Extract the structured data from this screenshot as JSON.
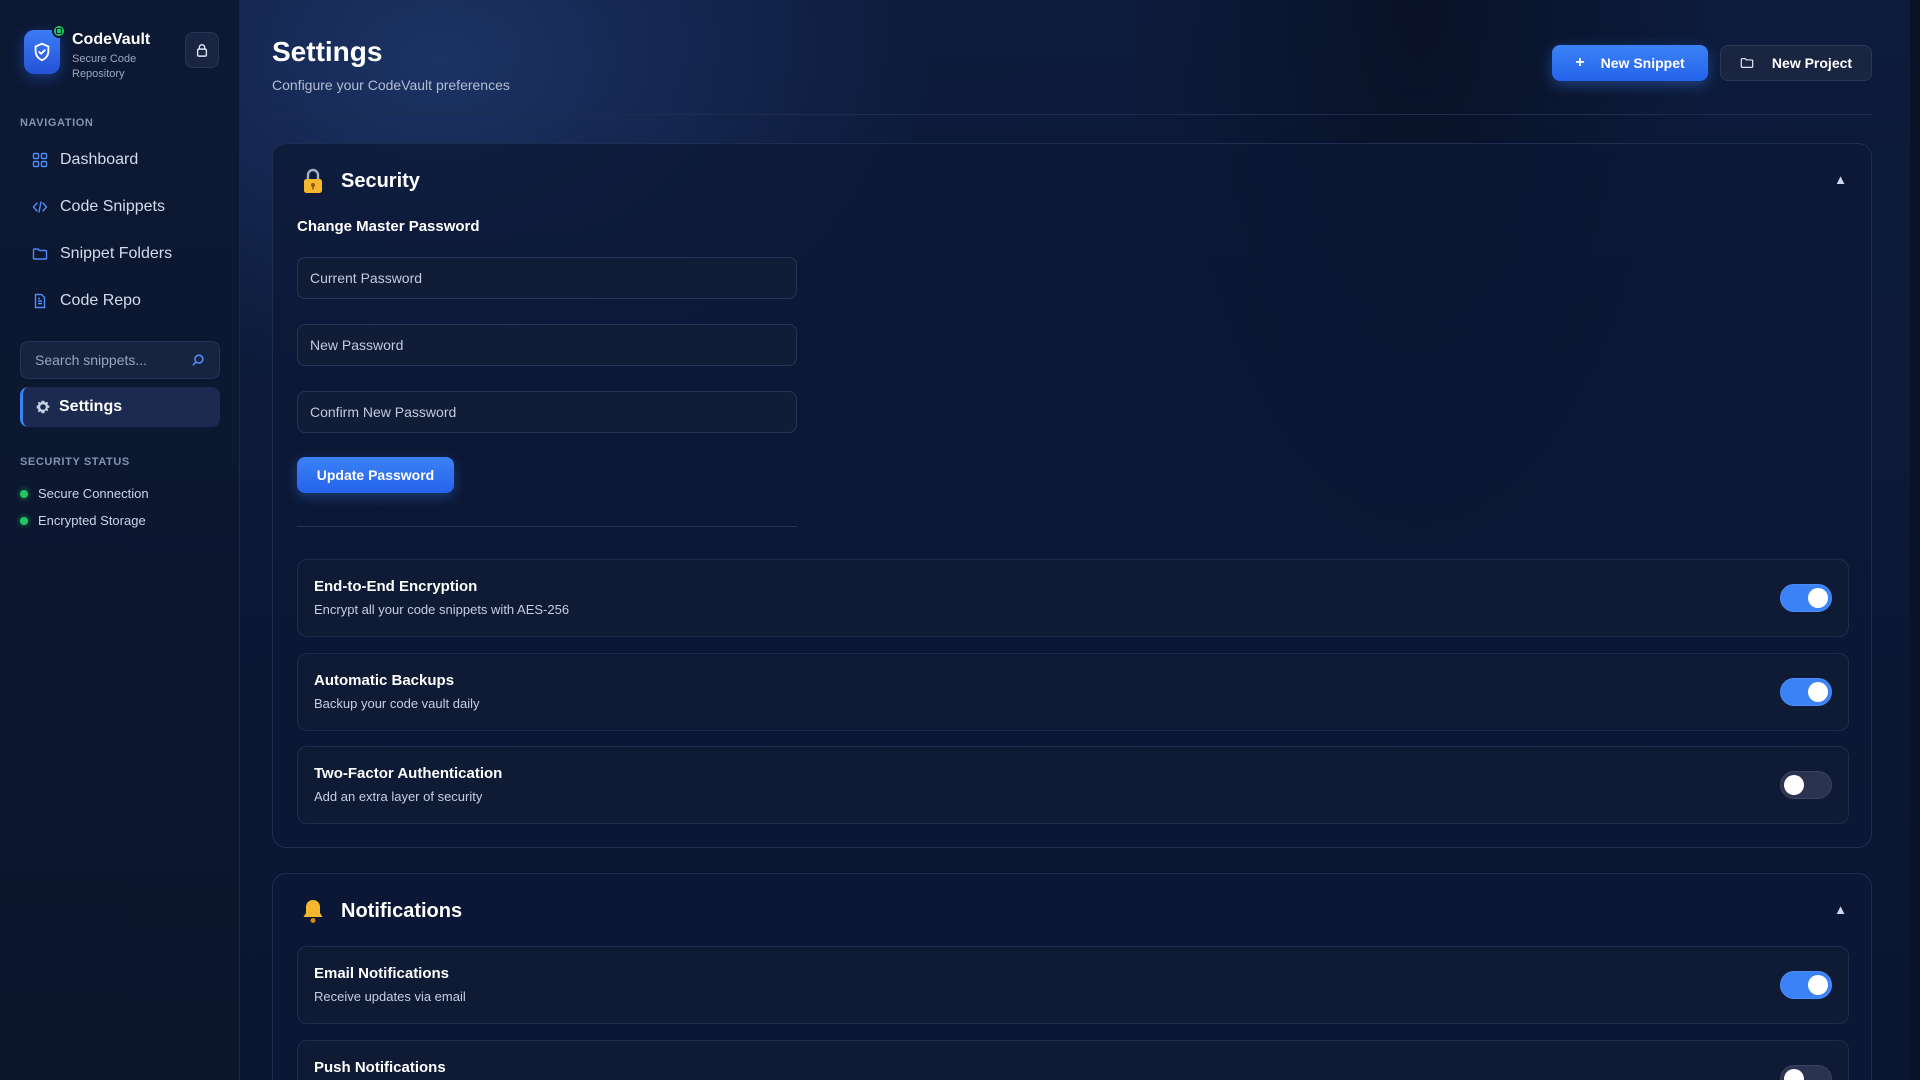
{
  "sidebar": {
    "brand_name": "CodeVault",
    "brand_sub": "Secure Code Repository",
    "nav_label": "NAVIGATION",
    "items": [
      {
        "label": "Dashboard",
        "icon": "grid-icon"
      },
      {
        "label": "Code Snippets",
        "icon": "code-icon"
      },
      {
        "label": "Snippet Folders",
        "icon": "folder-icon"
      },
      {
        "label": "Code Repo",
        "icon": "file-icon"
      }
    ],
    "search_placeholder": "Search snippets...",
    "settings_label": "Settings",
    "status_label": "SECURITY STATUS",
    "status": [
      {
        "label": "Secure Connection",
        "color": "#22c55e"
      },
      {
        "label": "Encrypted Storage",
        "color": "#22c55e"
      }
    ]
  },
  "header": {
    "title": "Settings",
    "subtitle": "Configure your CodeVault preferences",
    "new_snippet": "New Snippet",
    "new_project": "New Project"
  },
  "security": {
    "title": "Security",
    "change_pw_title": "Change Master Password",
    "current_pw_placeholder": "Current Password",
    "new_pw_placeholder": "New Password",
    "confirm_pw_placeholder": "Confirm New Password",
    "update_label": "Update Password",
    "settings": [
      {
        "title": "End-to-End Encryption",
        "desc": "Encrypt all your code snippets with AES-256",
        "enabled": true
      },
      {
        "title": "Automatic Backups",
        "desc": "Backup your code vault daily",
        "enabled": true
      },
      {
        "title": "Two-Factor Authentication",
        "desc": "Add an extra layer of security",
        "enabled": false
      }
    ]
  },
  "notifications": {
    "title": "Notifications",
    "settings": [
      {
        "title": "Email Notifications",
        "desc": "Receive updates via email",
        "enabled": true
      },
      {
        "title": "Push Notifications",
        "desc": "",
        "enabled": false
      }
    ]
  },
  "colors": {
    "accent": "#3b82f6",
    "success": "#22c55e",
    "background": "#0a1630"
  }
}
